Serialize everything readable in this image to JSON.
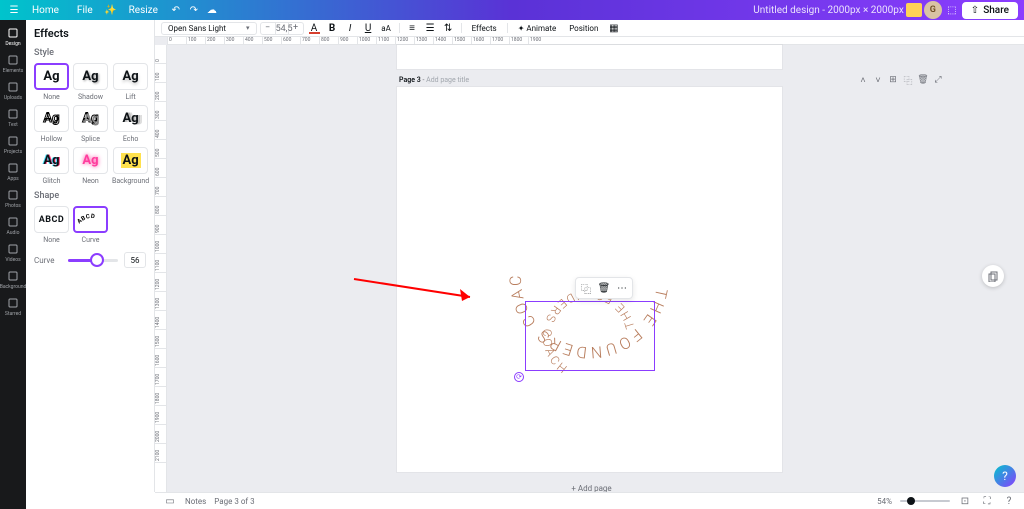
{
  "top": {
    "home": "Home",
    "file": "File",
    "resize": "Resize",
    "doc_title": "Untitled design - 2000px × 2000px",
    "avatar": "G",
    "share": "Share"
  },
  "rail": [
    {
      "name": "design",
      "label": "Design"
    },
    {
      "name": "elements",
      "label": "Elements"
    },
    {
      "name": "uploads",
      "label": "Uploads"
    },
    {
      "name": "text",
      "label": "Text"
    },
    {
      "name": "projects",
      "label": "Projects"
    },
    {
      "name": "apps",
      "label": "Apps"
    },
    {
      "name": "photos",
      "label": "Photos"
    },
    {
      "name": "audio",
      "label": "Audio"
    },
    {
      "name": "videos",
      "label": "Videos"
    },
    {
      "name": "bg",
      "label": "Background"
    },
    {
      "name": "starred",
      "label": "Starred"
    }
  ],
  "panel": {
    "title": "Effects",
    "style_h": "Style",
    "styles": [
      {
        "id": "none",
        "label": "None"
      },
      {
        "id": "shadow",
        "label": "Shadow"
      },
      {
        "id": "lift",
        "label": "Lift"
      },
      {
        "id": "hollow",
        "label": "Hollow"
      },
      {
        "id": "splice",
        "label": "Splice"
      },
      {
        "id": "echo",
        "label": "Echo"
      },
      {
        "id": "glitch",
        "label": "Glitch"
      },
      {
        "id": "neon",
        "label": "Neon"
      },
      {
        "id": "bg",
        "label": "Background"
      }
    ],
    "shape_h": "Shape",
    "shape_none": "None",
    "shape_curve": "Curve",
    "shape_sample": "ABCD",
    "curve_lbl": "Curve",
    "curve_val": "56"
  },
  "toolbar": {
    "font": "Open Sans Light",
    "size": "54,5",
    "effects": "Effects",
    "animate": "Animate",
    "position": "Position"
  },
  "ruler_h": [
    "0",
    "100",
    "200",
    "300",
    "400",
    "500",
    "600",
    "700",
    "800",
    "900",
    "1000",
    "1100",
    "1200",
    "1300",
    "1400",
    "1500",
    "1600",
    "1700",
    "1800",
    "1900"
  ],
  "ruler_v": [
    "0",
    "100",
    "200",
    "300",
    "400",
    "500",
    "600",
    "700",
    "800",
    "900",
    "1000",
    "1100",
    "1200",
    "1300",
    "1400",
    "1500",
    "1600",
    "1700",
    "1800",
    "1900",
    "2000",
    "2100"
  ],
  "page": {
    "label_a": "Page 3",
    "label_b": " - ",
    "placeholder": "Add page title",
    "circ_text": "THE FOUNDERS COACH ",
    "add": "+ Add page"
  },
  "bottom": {
    "notes": "Notes",
    "pages": "Page 3 of 3",
    "zoom": "54%"
  }
}
